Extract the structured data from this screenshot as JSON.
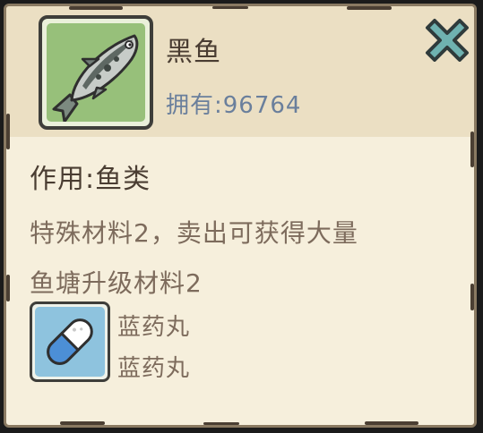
{
  "item": {
    "name": "黑鱼",
    "icon": "black-fish-icon",
    "own_label": "拥有:",
    "own_count": "96764"
  },
  "close_button": {
    "icon": "close-icon",
    "color": "#5b9a99"
  },
  "details": {
    "effect": "作用:鱼类",
    "description_line1": "特殊材料2，卖出可获得大量",
    "description_line2": "鱼塘升级材料2"
  },
  "reward": {
    "icon": "blue-pill-icon",
    "name": "蓝药丸",
    "subtext": "蓝药丸"
  },
  "colors": {
    "panel_bg": "#f6efdc",
    "header_bg": "#ebdfc3",
    "text_dark": "#4a3d32",
    "text_muted": "#7d6b5c",
    "count_blue": "#6a7f9c",
    "item_bg_green": "#97c07a",
    "reward_bg_blue": "#8ec3de"
  }
}
